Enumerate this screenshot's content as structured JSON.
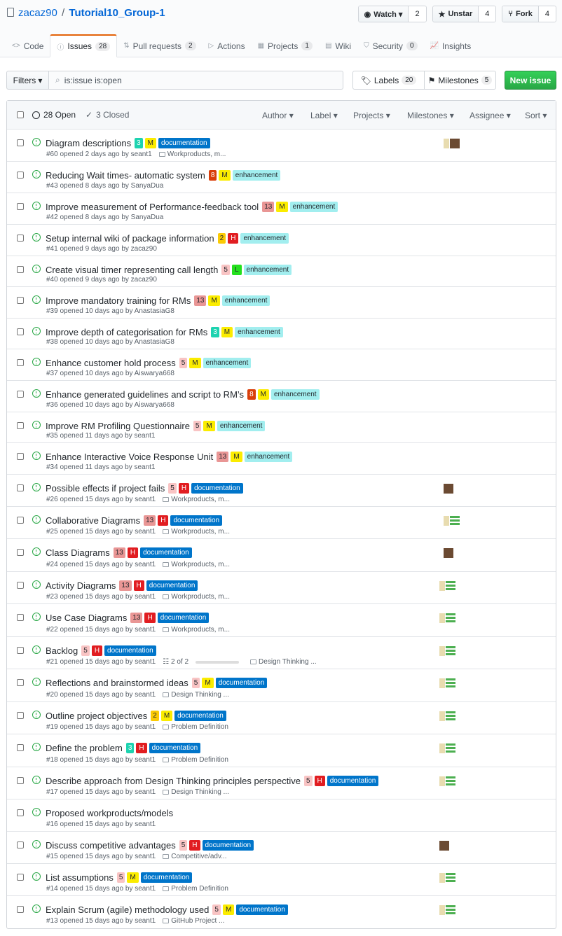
{
  "repo": {
    "owner": "zacaz90",
    "sep": "/",
    "name": "Tutorial10_Group-1"
  },
  "actions": [
    {
      "label": "Watch ▾",
      "count": "2",
      "icon": "eye-icon"
    },
    {
      "label": "Unstar",
      "count": "4",
      "icon": "star-icon"
    },
    {
      "label": "Fork",
      "count": "4",
      "icon": "fork-icon"
    }
  ],
  "tabs": [
    {
      "label": "Code",
      "count": ""
    },
    {
      "label": "Issues",
      "count": "28"
    },
    {
      "label": "Pull requests",
      "count": "2"
    },
    {
      "label": "Actions",
      "count": ""
    },
    {
      "label": "Projects",
      "count": "1"
    },
    {
      "label": "Wiki",
      "count": ""
    },
    {
      "label": "Security",
      "count": "0"
    },
    {
      "label": "Insights",
      "count": ""
    }
  ],
  "filters": {
    "button": "Filters",
    "query": "is:issue is:open"
  },
  "labels_btn": {
    "label": "Labels",
    "count": "20"
  },
  "milestones_btn": {
    "label": "Milestones",
    "count": "5"
  },
  "new_issue": "New issue",
  "list_header": {
    "open": "28 Open",
    "closed": "3 Closed",
    "filters": [
      "Author",
      "Label",
      "Projects",
      "Milestones",
      "Assignee",
      "Sort"
    ]
  },
  "colors": {
    "green": "#28a745",
    "doc": "#0075ca",
    "enh": "#a2eeef",
    "size13": "#e99695",
    "size8": "#d93f0b",
    "size5": "#f9c4c4",
    "size3": "#1dd3b0",
    "size2": "#fbca04",
    "H": "#e11d21",
    "M": "#fbec00",
    "L": "#24e01d"
  },
  "issues": [
    {
      "title": "Diagram descriptions",
      "size": "3",
      "prio": "M",
      "type": "documentation",
      "meta": "#60 opened 2 days ago by seant1",
      "project": "Workproducts, m..."
    },
    {
      "title": "Reducing Wait times- automatic system",
      "size": "8",
      "prio": "M",
      "type": "enhancement",
      "meta": "#43 opened 8 days ago by SanyaDua",
      "project": ""
    },
    {
      "title": "Improve measurement of Performance-feedback tool",
      "size": "13",
      "prio": "M",
      "type": "enhancement",
      "meta": "#42 opened 8 days ago by SanyaDua",
      "project": ""
    },
    {
      "title": "Setup internal wiki of package information",
      "size": "2",
      "prio": "H",
      "type": "enhancement",
      "meta": "#41 opened 9 days ago by zacaz90",
      "project": ""
    },
    {
      "title": "Create visual timer representing call length",
      "size": "5",
      "prio": "L",
      "type": "enhancement",
      "meta": "#40 opened 9 days ago by zacaz90",
      "project": ""
    },
    {
      "title": "Improve mandatory training for RMs",
      "size": "13",
      "prio": "M",
      "type": "enhancement",
      "meta": "#39 opened 10 days ago by AnastasiaG8",
      "project": ""
    },
    {
      "title": "Improve depth of categorisation for RMs",
      "size": "3",
      "prio": "M",
      "type": "enhancement",
      "meta": "#38 opened 10 days ago by AnastasiaG8",
      "project": ""
    },
    {
      "title": "Enhance customer hold process",
      "size": "5",
      "prio": "M",
      "type": "enhancement",
      "meta": "#37 opened 10 days ago by Aiswarya668",
      "project": ""
    },
    {
      "title": "Enhance generated guidelines and script to RM’s",
      "size": "8",
      "prio": "M",
      "type": "enhancement",
      "meta": "#36 opened 10 days ago by Aiswarya668",
      "project": ""
    },
    {
      "title": "Improve RM Profiling Questionnaire",
      "size": "5",
      "prio": "M",
      "type": "enhancement",
      "meta": "#35 opened 11 days ago by seant1",
      "project": ""
    },
    {
      "title": "Enhance Interactive Voice Response Unit",
      "size": "13",
      "prio": "M",
      "type": "enhancement",
      "meta": "#34 opened 11 days ago by seant1",
      "project": ""
    },
    {
      "title": "Possible effects if project fails",
      "size": "5",
      "prio": "H",
      "type": "documentation",
      "meta": "#26 opened 15 days ago by seant1",
      "project": "Workproducts, m..."
    },
    {
      "title": "Collaborative Diagrams",
      "size": "13",
      "prio": "H",
      "type": "documentation",
      "meta": "#25 opened 15 days ago by seant1",
      "project": "Workproducts, m..."
    },
    {
      "title": "Class Diagrams",
      "size": "13",
      "prio": "H",
      "type": "documentation",
      "meta": "#24 opened 15 days ago by seant1",
      "project": "Workproducts, m..."
    },
    {
      "title": "Activity Diagrams",
      "size": "13",
      "prio": "H",
      "type": "documentation",
      "meta": "#23 opened 15 days ago by seant1",
      "project": "Workproducts, m..."
    },
    {
      "title": "Use Case Diagrams",
      "size": "13",
      "prio": "H",
      "type": "documentation",
      "meta": "#22 opened 15 days ago by seant1",
      "project": "Workproducts, m..."
    },
    {
      "title": "Backlog",
      "size": "5",
      "prio": "H",
      "type": "documentation",
      "meta": "#21 opened 15 days ago by seant1",
      "project": "Design Thinking ...",
      "tasks": "2 of 2"
    },
    {
      "title": "Reflections and brainstormed ideas",
      "size": "5",
      "prio": "M",
      "type": "documentation",
      "meta": "#20 opened 15 days ago by seant1",
      "project": "Design Thinking ..."
    },
    {
      "title": "Outline project objectives",
      "size": "2",
      "prio": "M",
      "type": "documentation",
      "meta": "#19 opened 15 days ago by seant1",
      "project": "Problem Definition"
    },
    {
      "title": "Define the problem",
      "size": "3",
      "prio": "H",
      "type": "documentation",
      "meta": "#18 opened 15 days ago by seant1",
      "project": "Problem Definition"
    },
    {
      "title": "Describe approach from Design Thinking principles perspective",
      "size": "5",
      "prio": "H",
      "type": "documentation",
      "meta": "#17 opened 15 days ago by seant1",
      "project": "Design Thinking ..."
    },
    {
      "title": "Proposed workproducts/models",
      "size": "",
      "prio": "",
      "type": "",
      "meta": "#16 opened 15 days ago by seant1",
      "project": ""
    },
    {
      "title": "Discuss competitive advantages",
      "size": "5",
      "prio": "H",
      "type": "documentation",
      "meta": "#15 opened 15 days ago by seant1",
      "project": "Competitive/adv..."
    },
    {
      "title": "List assumptions",
      "size": "5",
      "prio": "M",
      "type": "documentation",
      "meta": "#14 opened 15 days ago by seant1",
      "project": "Problem Definition"
    },
    {
      "title": "Explain Scrum (agile) methodology used",
      "size": "5",
      "prio": "M",
      "type": "documentation",
      "meta": "#13 opened 15 days ago by seant1",
      "project": "GitHub Project ..."
    }
  ]
}
